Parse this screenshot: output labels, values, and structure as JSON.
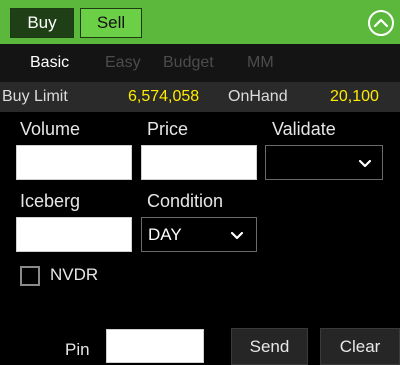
{
  "topbar": {
    "buy_label": "Buy",
    "sell_label": "Sell",
    "collapse_icon": "chevron-up-circle"
  },
  "tabs": [
    {
      "label": "Basic",
      "active": true
    },
    {
      "label": "Easy",
      "active": false
    },
    {
      "label": "Budget",
      "active": false
    },
    {
      "label": "MM",
      "active": false
    }
  ],
  "info": {
    "buy_limit_label": "Buy Limit",
    "buy_limit_value": "6,574,058",
    "onhand_label": "OnHand",
    "onhand_value": "20,100"
  },
  "form": {
    "volume_label": "Volume",
    "volume_value": "",
    "price_label": "Price",
    "price_value": "",
    "validate_label": "Validate",
    "validate_value": "",
    "iceberg_label": "Iceberg",
    "iceberg_value": "",
    "condition_label": "Condition",
    "condition_value": "DAY",
    "nvdr_label": "NVDR",
    "nvdr_checked": false
  },
  "footer": {
    "pin_label": "Pin",
    "pin_value": "",
    "send_label": "Send",
    "clear_label": "Clear"
  },
  "colors": {
    "accent_green": "#5cb83d",
    "active_tab_green": "#1f3f16",
    "value_yellow": "#ffeb00"
  }
}
